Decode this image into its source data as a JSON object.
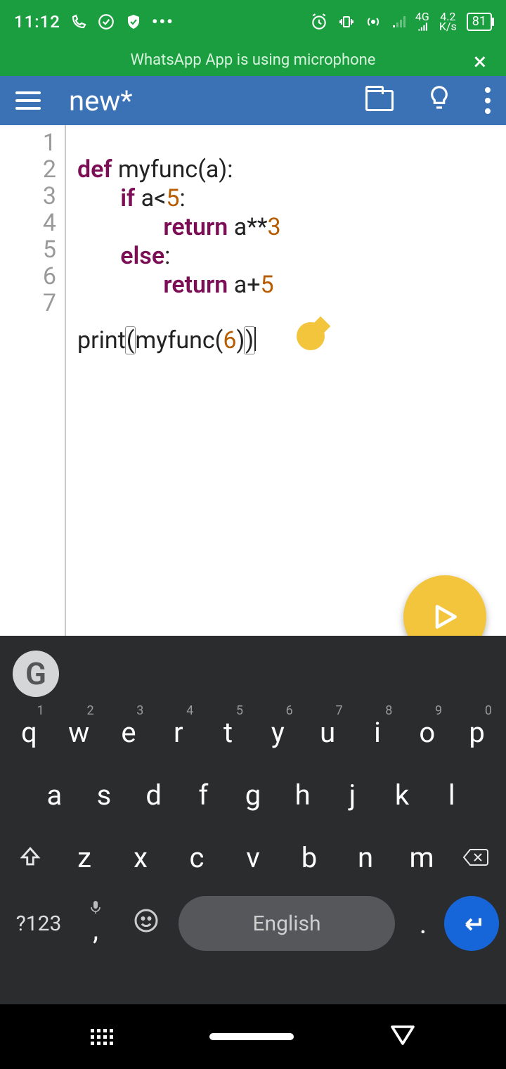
{
  "status": {
    "time": "11:12",
    "net_speed": "4.2",
    "net_unit": "K/s",
    "net_gen": "4G",
    "battery": "81"
  },
  "notification": {
    "text": "WhatsApp App is using microphone"
  },
  "appbar": {
    "title": "new*"
  },
  "editor": {
    "lines": [
      "1",
      "2",
      "3",
      "4",
      "5",
      "6",
      "7"
    ],
    "code": {
      "l1_def": "def",
      "l1_rest": " myfunc(a):",
      "l2_if": "if",
      "l2_rest": " a<",
      "l2_num": "5",
      "l2_colon": ":",
      "l3_ret": "return",
      "l3_rest": " a**",
      "l3_num": "3",
      "l4_else": "else",
      "l4_colon": ":",
      "l5_ret": "return",
      "l5_rest": " a+",
      "l5_num": "5",
      "l7_print": "print",
      "l7_open": "(",
      "l7_func": "myfunc(",
      "l7_arg": "6",
      "l7_close1": ")",
      "l7_close2": ")"
    }
  },
  "keyboard": {
    "toolbar_letter": "G",
    "row1": [
      {
        "k": "q",
        "n": "1"
      },
      {
        "k": "w",
        "n": "2"
      },
      {
        "k": "e",
        "n": "3"
      },
      {
        "k": "r",
        "n": "4"
      },
      {
        "k": "t",
        "n": "5"
      },
      {
        "k": "y",
        "n": "6"
      },
      {
        "k": "u",
        "n": "7"
      },
      {
        "k": "i",
        "n": "8"
      },
      {
        "k": "o",
        "n": "9"
      },
      {
        "k": "p",
        "n": "0"
      }
    ],
    "row2": [
      "a",
      "s",
      "d",
      "f",
      "g",
      "h",
      "j",
      "k",
      "l"
    ],
    "row3": [
      "z",
      "x",
      "c",
      "v",
      "b",
      "n",
      "m"
    ],
    "symbols_label": "?123",
    "comma": ",",
    "space_label": "English",
    "period": "."
  }
}
